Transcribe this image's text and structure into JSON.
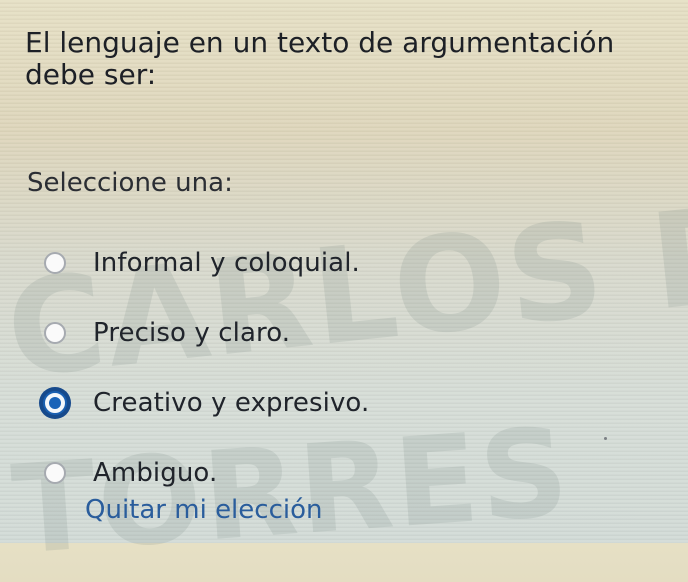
{
  "question": {
    "text": "El lenguaje en un texto de argumentación debe ser:"
  },
  "prompt": {
    "text": "Seleccione una:"
  },
  "options": [
    {
      "label": "Informal y coloquial.",
      "selected": false
    },
    {
      "label": "Preciso y claro.",
      "selected": false
    },
    {
      "label": "Creativo y expresivo.",
      "selected": true
    },
    {
      "label": "Ambiguo.",
      "selected": false
    }
  ],
  "actions": {
    "clear_choice": "Quitar mi elección"
  },
  "watermark": {
    "line1": "CARLOS DAV",
    "line2": "TORRES"
  },
  "colors": {
    "selected_radio": "#1a63b8",
    "link": "#2a5d9c",
    "text": "#1e2128"
  }
}
